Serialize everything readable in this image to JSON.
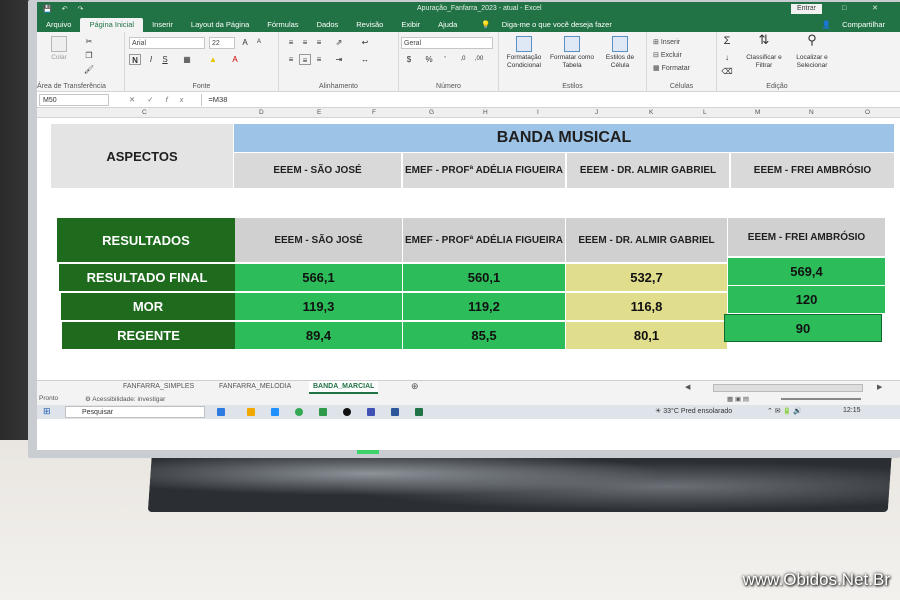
{
  "window": {
    "title": "Apuração_Fanfarra_2023 - atual - Excel",
    "enter_button": "Entrar",
    "controls": "— □ ✕"
  },
  "ribbon_tabs": [
    "Arquivo",
    "Página Inicial",
    "Inserir",
    "Layout da Página",
    "Fórmulas",
    "Dados",
    "Revisão",
    "Exibir",
    "Ajuda"
  ],
  "tell_me": "Diga-me o que você deseja fazer",
  "share": "Compartilhar",
  "ribbon": {
    "paste": "Colar",
    "clipboard_label": "Área de Transferência",
    "font_name": "Arial",
    "font_size": "22",
    "font_label": "Fonte",
    "alignment_label": "Alinhamento",
    "number_format": "Geral",
    "number_label": "Número",
    "cond_format": "Formatação Condicional",
    "format_table": "Formatar como Tabela",
    "cell_styles": "Estilos de Célula",
    "styles_label": "Estilos",
    "insert": "Inserir",
    "delete": "Excluir",
    "format": "Formatar",
    "cells_label": "Células",
    "sort_filter": "Classificar e Filtrar",
    "find_select": "Localizar e Selecionar",
    "editing_label": "Edição"
  },
  "formula_bar": {
    "name_box": "M50",
    "formula": "=M38"
  },
  "column_headers": [
    "C",
    "D",
    "E",
    "F",
    "G",
    "H",
    "I",
    "J",
    "K",
    "L",
    "M",
    "N",
    "O"
  ],
  "table1": {
    "aspectos": "ASPECTOS",
    "banda": "BANDA MUSICAL",
    "schools": [
      "EEEM - SÃO JOSÉ",
      "EMEF - PROFª ADÉLIA FIGUEIRA",
      "EEEM - DR. ALMIR GABRIEL",
      "EEEM - FREI AMBRÓSIO"
    ]
  },
  "table2": {
    "resultados": "RESULTADOS",
    "schools": [
      "EEEM - SÃO JOSÉ",
      "EMEF - PROFª ADÉLIA FIGUEIRA",
      "EEEM - DR. ALMIR GABRIEL",
      "EEEM - FREI AMBRÓSIO"
    ],
    "rows": [
      {
        "label": "RESULTADO FINAL",
        "values": [
          "566,1",
          "560,1",
          "532,7",
          "569,4"
        ]
      },
      {
        "label": "MOR",
        "values": [
          "119,3",
          "119,2",
          "116,8",
          "120"
        ]
      },
      {
        "label": "REGENTE",
        "values": [
          "89,4",
          "85,5",
          "80,1",
          "90"
        ]
      }
    ]
  },
  "colors": {
    "excel_green": "#217346",
    "dark_green": "#1e6b1e",
    "green": "#2cbd5a",
    "yellow": "#e0dd8c",
    "header_blue": "#9dc3e6"
  },
  "sheet_tabs": [
    "FANFARRA_SIMPLES",
    "FANFARRA_MELODIA",
    "BANDA_MARCIAL"
  ],
  "status": {
    "ready": "Pronto",
    "accessibility": "Acessibilidade: investigar"
  },
  "taskbar": {
    "search": "Pesquisar",
    "weather": "33°C  Pred ensolarado",
    "time": "12:15"
  },
  "watermark": "www.Obidos.Net.Br"
}
